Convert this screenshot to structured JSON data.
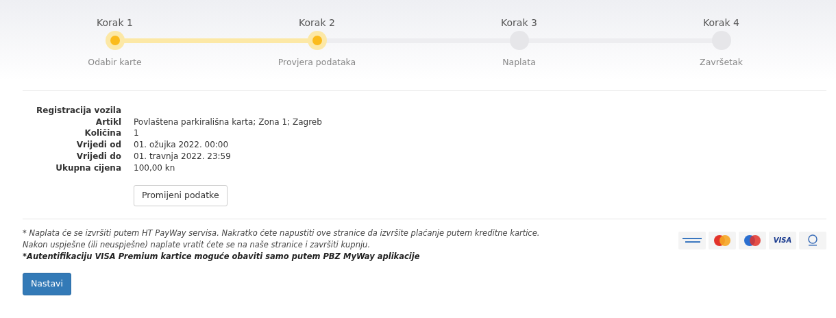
{
  "steps": [
    {
      "title": "Korak 1",
      "label": "Odabir karte",
      "completed": true
    },
    {
      "title": "Korak 2",
      "label": "Provjera podataka",
      "completed": true
    },
    {
      "title": "Korak 3",
      "label": "Naplata",
      "completed": false
    },
    {
      "title": "Korak 4",
      "label": "Završetak",
      "completed": false
    }
  ],
  "details": [
    {
      "label": "Registracija vozila"
    },
    {
      "label": "Artikl",
      "value": "Povlaštena parkirališna karta; Zona 1; Zagreb"
    },
    {
      "label": "Količina",
      "value": "1"
    },
    {
      "label": "Vrijedi od",
      "value": "01. ožujka 2022. 00:00"
    },
    {
      "label": "Vrijedi do",
      "value": "01. travnja 2022. 23:59"
    },
    {
      "label": "Ukupna cijena",
      "value": "100,00 kn"
    }
  ],
  "change_button": "Promijeni podatke",
  "notes": [
    {
      "kind": "info",
      "text": "* Naplata će se izvršiti putem HT PayWay servisa. Nakratko ćete napustiti ove stranice da izvršite plaćanje putem kreditne kartice. Nakon uspješne (ili neuspješne) naplate vratit ćete se na naše stranice i završiti kupnju."
    },
    {
      "kind": "warning",
      "text": "*Autentifikaciju VISA Premium kartice moguće obaviti samo putem PBZ MyWay aplikacije"
    }
  ],
  "cards": [
    {
      "kind": "amex"
    },
    {
      "kind": "mastercard"
    },
    {
      "kind": "maestro"
    },
    {
      "kind": "visa",
      "label": "VISA"
    },
    {
      "kind": "diners"
    }
  ],
  "continue_button": "Nastavi"
}
